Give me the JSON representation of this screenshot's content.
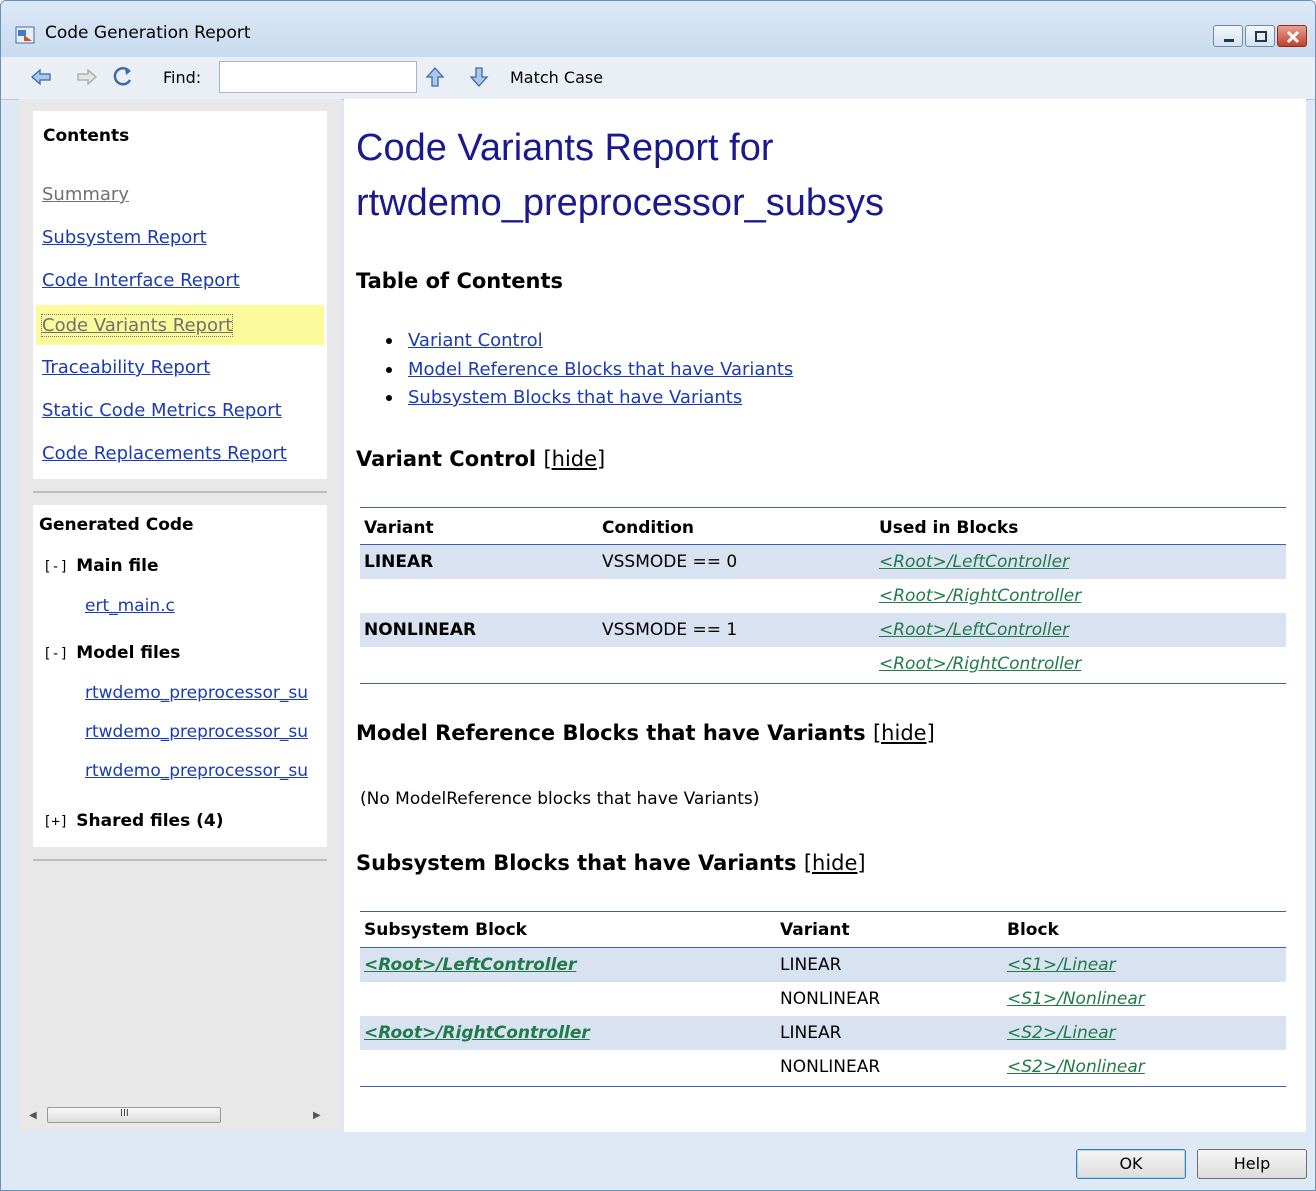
{
  "window": {
    "title": "Code Generation Report"
  },
  "toolbar": {
    "find_label": "Find:",
    "find_value": "",
    "match_case": "Match Case"
  },
  "sidebar": {
    "contents_title": "Contents",
    "nav": [
      {
        "label": "Summary"
      },
      {
        "label": "Subsystem Report"
      },
      {
        "label": "Code Interface Report"
      },
      {
        "label": "Code Variants Report"
      },
      {
        "label": "Traceability Report"
      },
      {
        "label": "Static Code Metrics Report"
      },
      {
        "label": "Code Replacements Report"
      }
    ],
    "generated_title": "Generated Code",
    "main_file": {
      "toggle": "[-]",
      "label": "Main file",
      "files": [
        "ert_main.c"
      ]
    },
    "model_files": {
      "toggle": "[-]",
      "label": "Model files",
      "files": [
        "rtwdemo_preprocessor_su",
        "rtwdemo_preprocessor_su",
        "rtwdemo_preprocessor_su"
      ]
    },
    "shared_files": {
      "toggle": "[+]",
      "label": "Shared files (4)"
    }
  },
  "main": {
    "title_line1": "Code Variants Report for",
    "title_line2": "rtwdemo_preprocessor_subsys",
    "toc_title": "Table of Contents",
    "toc": [
      "Variant Control",
      "Model Reference Blocks that have Variants",
      "Subsystem Blocks that have Variants"
    ],
    "hide": "[hide]",
    "variant_control": {
      "title": "Variant Control",
      "headers": [
        "Variant",
        "Condition",
        "Used in Blocks"
      ],
      "rows": [
        [
          "LINEAR",
          "VSSMODE == 0",
          "<Root>/LeftController"
        ],
        [
          "",
          "",
          "<Root>/RightController"
        ],
        [
          "NONLINEAR",
          "VSSMODE == 1",
          "<Root>/LeftController"
        ],
        [
          "",
          "",
          "<Root>/RightController"
        ]
      ]
    },
    "model_ref": {
      "title": "Model Reference Blocks that have Variants",
      "empty": "(No ModelReference blocks that have Variants)"
    },
    "subsystem": {
      "title": "Subsystem Blocks that have Variants",
      "headers": [
        "Subsystem Block",
        "Variant",
        "Block"
      ],
      "rows": [
        [
          "<Root>/LeftController",
          "LINEAR",
          "<S1>/Linear"
        ],
        [
          "",
          "NONLINEAR",
          "<S1>/Nonlinear"
        ],
        [
          "<Root>/RightController",
          "LINEAR",
          "<S2>/Linear"
        ],
        [
          "",
          "NONLINEAR",
          "<S2>/Nonlinear"
        ]
      ]
    }
  },
  "buttons": {
    "ok": "OK",
    "help": "Help"
  },
  "colors": {
    "link": "#1a3bb5",
    "green_link": "#207a4a",
    "title": "#1a1a8c",
    "row_shade": "#d9e2f1",
    "highlight": "#fbfb9b"
  },
  "icons": [
    "back-arrow-icon",
    "forward-arrow-icon",
    "refresh-icon",
    "find-up-icon",
    "find-down-icon"
  ]
}
